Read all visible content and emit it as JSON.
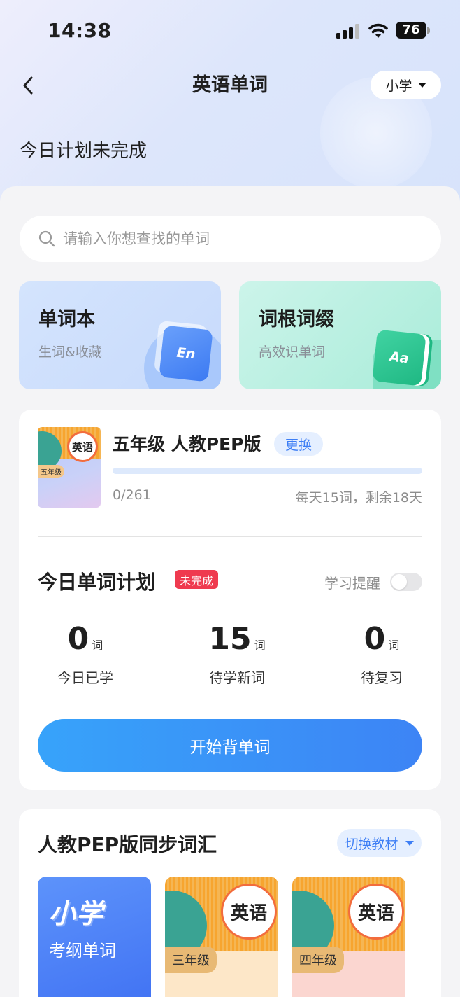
{
  "status_bar": {
    "time": "14:38",
    "battery": "76"
  },
  "nav": {
    "title": "英语单词",
    "grade_selector": "小学"
  },
  "header": {
    "plan_status": "今日计划未完成"
  },
  "search": {
    "placeholder": "请输入你想查找的单词"
  },
  "feature_cards": [
    {
      "title": "单词本",
      "subtitle": "生词&收藏",
      "icon_text": "En"
    },
    {
      "title": "词根词缀",
      "subtitle": "高效识单词",
      "icon_text": "Aa"
    }
  ],
  "textbook": {
    "cover_subject": "英语",
    "cover_grade": "五年级",
    "name": "五年级 人教PEP版",
    "change_label": "更换",
    "progress_text": "0/261",
    "learned": 0,
    "total": 261,
    "progress_fraction": 0.0,
    "note": "每天15词，剩余18天"
  },
  "plan": {
    "title": "今日单词计划",
    "badge": "未完成",
    "reminder_label": "学习提醒",
    "reminder_on": false,
    "stats": [
      {
        "value": "0",
        "unit": "词",
        "label": "今日已学"
      },
      {
        "value": "15",
        "unit": "词",
        "label": "待学新词"
      },
      {
        "value": "0",
        "unit": "词",
        "label": "待复习"
      }
    ],
    "start_button": "开始背单词"
  },
  "sync": {
    "title": "人教PEP版同步词汇",
    "switch_label": "切换教材",
    "books": [
      {
        "big": "小学",
        "sub": "考纲单词"
      },
      {
        "subject": "英语",
        "grade": "三年级"
      },
      {
        "subject": "英语",
        "grade": "四年级"
      }
    ]
  },
  "colors": {
    "accent": "#3d7ef5",
    "badge_red": "#ef3a4f",
    "button_start": "#37a3fa",
    "button_end": "#3d84f5"
  }
}
